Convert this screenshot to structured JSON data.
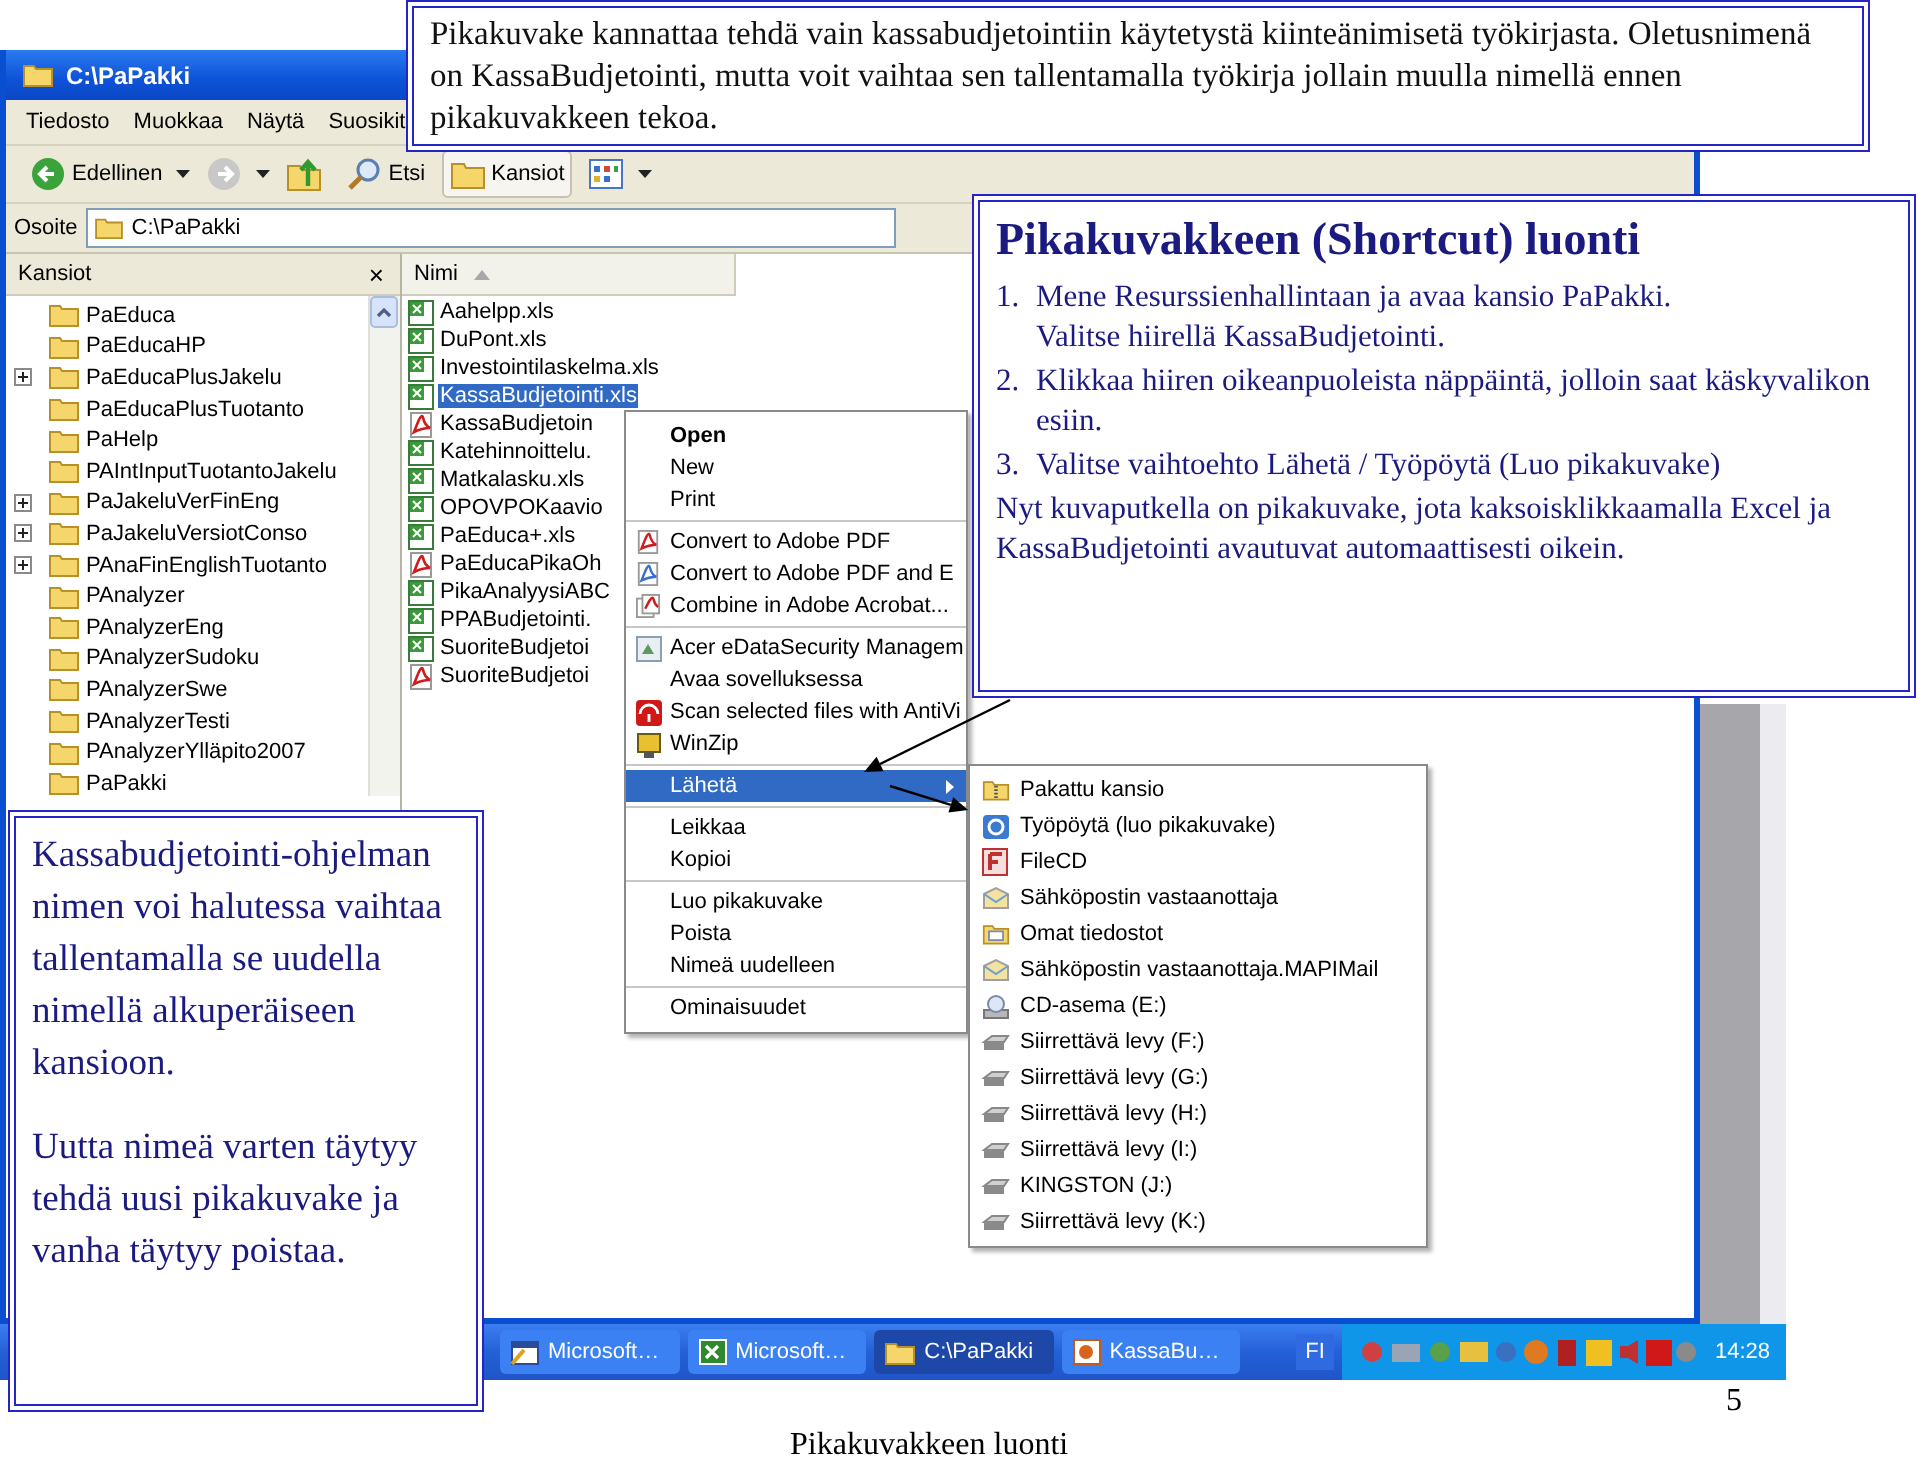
{
  "window": {
    "title": "C:\\PaPakki",
    "menu": [
      "Tiedosto",
      "Muokkaa",
      "Näytä",
      "Suosikit"
    ],
    "toolbar": [
      {
        "kind": "back",
        "label": "Edellinen",
        "pressed": false,
        "dropdown": true
      },
      {
        "kind": "forward",
        "pressed": false,
        "dropdown": true
      },
      {
        "kind": "up",
        "pressed": false,
        "dropdown": false
      },
      {
        "kind": "search",
        "label": "Etsi",
        "pressed": false,
        "dropdown": false
      },
      {
        "kind": "folders",
        "label": "Kansiot",
        "pressed": true,
        "dropdown": false
      },
      {
        "kind": "views",
        "pressed": false,
        "dropdown": true
      }
    ],
    "address": {
      "label": "Osoite",
      "value": "C:\\PaPakki"
    },
    "folder_pane": {
      "title": "Kansiot",
      "close": "×",
      "folders": [
        {
          "name": "PaEduca",
          "expandable": false
        },
        {
          "name": "PaEducaHP",
          "expandable": false
        },
        {
          "name": "PaEducaPlusJakelu",
          "expandable": true
        },
        {
          "name": "PaEducaPlusTuotanto",
          "expandable": false
        },
        {
          "name": "PaHelp",
          "expandable": false
        },
        {
          "name": "PAIntInputTuotantoJakelu",
          "expandable": false
        },
        {
          "name": "PaJakeluVerFinEng",
          "expandable": true
        },
        {
          "name": "PaJakeluVersiotConso",
          "expandable": true
        },
        {
          "name": "PAnaFinEnglishTuotanto",
          "expandable": true
        },
        {
          "name": "PAnalyzer",
          "expandable": false
        },
        {
          "name": "PAnalyzerEng",
          "expandable": false
        },
        {
          "name": "PAnalyzerSudoku",
          "expandable": false
        },
        {
          "name": "PAnalyzerSwe",
          "expandable": false
        },
        {
          "name": "PAnalyzerTesti",
          "expandable": false
        },
        {
          "name": "PAnalyzerYlläpito2007",
          "expandable": false
        },
        {
          "name": "PaPakki",
          "expandable": false
        }
      ]
    },
    "file_list": {
      "column": "Nimi",
      "files": [
        {
          "name": "Aahelpp.xls",
          "kind": "excel",
          "selected": false
        },
        {
          "name": "DuPont.xls",
          "kind": "excel",
          "selected": false
        },
        {
          "name": "Investointilaskelma.xls",
          "kind": "excel",
          "selected": false
        },
        {
          "name": "KassaBudjetointi.xls",
          "kind": "excel",
          "selected": true
        },
        {
          "name": "KassaBudjetoin",
          "kind": "pdf",
          "selected": false
        },
        {
          "name": "Katehinnoittelu.",
          "kind": "excel",
          "selected": false
        },
        {
          "name": "Matkalasku.xls",
          "kind": "excel",
          "selected": false
        },
        {
          "name": "OPOVPOKaavio",
          "kind": "excel",
          "selected": false
        },
        {
          "name": "PaEduca+.xls",
          "kind": "excel",
          "selected": false
        },
        {
          "name": "PaEducaPikaOh",
          "kind": "pdf",
          "selected": false
        },
        {
          "name": "PikaAnalyysiABC",
          "kind": "excel",
          "selected": false
        },
        {
          "name": "PPABudjetointi.",
          "kind": "excel",
          "selected": false
        },
        {
          "name": "SuoriteBudjetoi",
          "kind": "excel",
          "selected": false
        },
        {
          "name": "SuoriteBudjetoi",
          "kind": "pdf",
          "selected": false
        }
      ]
    }
  },
  "context_menu": {
    "groups": [
      [
        {
          "label": "Open",
          "kind": "plain",
          "bold": true,
          "selected": false,
          "submenu": false
        },
        {
          "label": "New",
          "kind": "plain",
          "bold": false,
          "selected": false,
          "submenu": false
        },
        {
          "label": "Print",
          "kind": "plain",
          "bold": false,
          "selected": false,
          "submenu": false
        }
      ],
      [
        {
          "label": "Convert to Adobe PDF",
          "kind": "pdf",
          "bold": false,
          "selected": false,
          "submenu": false
        },
        {
          "label": "Convert to Adobe PDF and E",
          "kind": "pdf-mail",
          "bold": false,
          "selected": false,
          "submenu": false
        },
        {
          "label": "Combine in Adobe Acrobat...",
          "kind": "acrobat",
          "bold": false,
          "selected": false,
          "submenu": false
        }
      ],
      [
        {
          "label": "Acer eDataSecurity Managem",
          "kind": "acer",
          "bold": false,
          "selected": false,
          "submenu": false
        },
        {
          "label": "Avaa sovelluksessa",
          "kind": "plain",
          "bold": false,
          "selected": false,
          "submenu": false
        },
        {
          "label": "Scan selected files with AntiVi",
          "kind": "antivir",
          "bold": false,
          "selected": false,
          "submenu": false
        },
        {
          "label": "WinZip",
          "kind": "winzip",
          "bold": false,
          "selected": false,
          "submenu": false
        }
      ],
      [
        {
          "label": "Lähetä",
          "kind": "plain",
          "bold": false,
          "selected": true,
          "submenu": true
        }
      ],
      [
        {
          "label": "Leikkaa",
          "kind": "plain",
          "bold": false,
          "selected": false,
          "submenu": false
        },
        {
          "label": "Kopioi",
          "kind": "plain",
          "bold": false,
          "selected": false,
          "submenu": false
        }
      ],
      [
        {
          "label": "Luo pikakuvake",
          "kind": "plain",
          "bold": false,
          "selected": false,
          "submenu": false
        },
        {
          "label": "Poista",
          "kind": "plain",
          "bold": false,
          "selected": false,
          "submenu": false
        },
        {
          "label": "Nimeä uudelleen",
          "kind": "plain",
          "bold": false,
          "selected": false,
          "submenu": false
        }
      ],
      [
        {
          "label": "Ominaisuudet",
          "kind": "plain",
          "bold": false,
          "selected": false,
          "submenu": false
        }
      ]
    ]
  },
  "send_to_menu": {
    "items": [
      {
        "label": "Pakattu kansio",
        "kind": "zip"
      },
      {
        "label": "Työpöytä (luo pikakuvake)",
        "kind": "desktop"
      },
      {
        "label": "FileCD",
        "kind": "filecd"
      },
      {
        "label": "Sähköpostin vastaanottaja",
        "kind": "mail"
      },
      {
        "label": "Omat tiedostot",
        "kind": "documents"
      },
      {
        "label": "Sähköpostin vastaanottaja.MAPIMail",
        "kind": "mail"
      },
      {
        "label": "CD-asema (E:)",
        "kind": "cd"
      },
      {
        "label": "Siirrettävä levy (F:)",
        "kind": "drive"
      },
      {
        "label": "Siirrettävä levy (G:)",
        "kind": "drive"
      },
      {
        "label": "Siirrettävä levy (H:)",
        "kind": "drive"
      },
      {
        "label": "Siirrettävä levy (I:)",
        "kind": "drive"
      },
      {
        "label": "KINGSTON (J:)",
        "kind": "drive"
      },
      {
        "label": "Siirrettävä levy (K:)",
        "kind": "drive"
      }
    ]
  },
  "taskbar": {
    "buttons": [
      {
        "label": "Microsoft…",
        "kind": "app",
        "selected": false
      },
      {
        "label": "Microsoft…",
        "kind": "excel",
        "selected": false
      },
      {
        "label": "C:\\PaPakki",
        "kind": "folder",
        "selected": true
      },
      {
        "label": "KassaBu…",
        "kind": "powerpoint",
        "selected": false
      }
    ],
    "language": "FI",
    "clock": "14:28"
  },
  "callouts": {
    "top": "Pikakuvake kannattaa tehdä vain kassabudjetointiin käytetystä kiinteänimisetä työkirjasta. Oletusnimenä on KassaBudjetointi, mutta voit vaihtaa sen tallentamalla työkirja jollain muulla nimellä ennen pikakuvakkeen tekoa.",
    "right": {
      "title": "Pikakuvakkeen (Shortcut) luonti",
      "steps": [
        {
          "number": "1.",
          "lines": [
            "Mene Resurssienhallintaan ja avaa kansio PaPakki.",
            "Valitse hiirellä KassaBudjetointi."
          ]
        },
        {
          "number": "2.",
          "lines": [
            "Klikkaa hiiren oikeanpuoleista näppäintä, jolloin saat käskyvalikon esiin."
          ]
        },
        {
          "number": "3.",
          "lines": [
            "Valitse vaihtoehto Lähetä / Työpöytä (Luo pikakuvake)"
          ]
        }
      ],
      "note": "Nyt kuvaputkella on pikakuvake, jota kaksoisklikkaamalla Excel ja KassaBudjetointi avautuvat automaattisesti oikein."
    },
    "left": [
      "Kassabudjetointi-ohjelman nimen voi halutessa vaihtaa tallentamalla se uudella nimellä alkuperäiseen kansioon.",
      "Uutta nimeä varten täytyy tehdä uusi pikakuvake ja vanha täytyy poistaa."
    ]
  },
  "footer": {
    "title": "Pikakuvakkeen luonti",
    "page": "5"
  }
}
